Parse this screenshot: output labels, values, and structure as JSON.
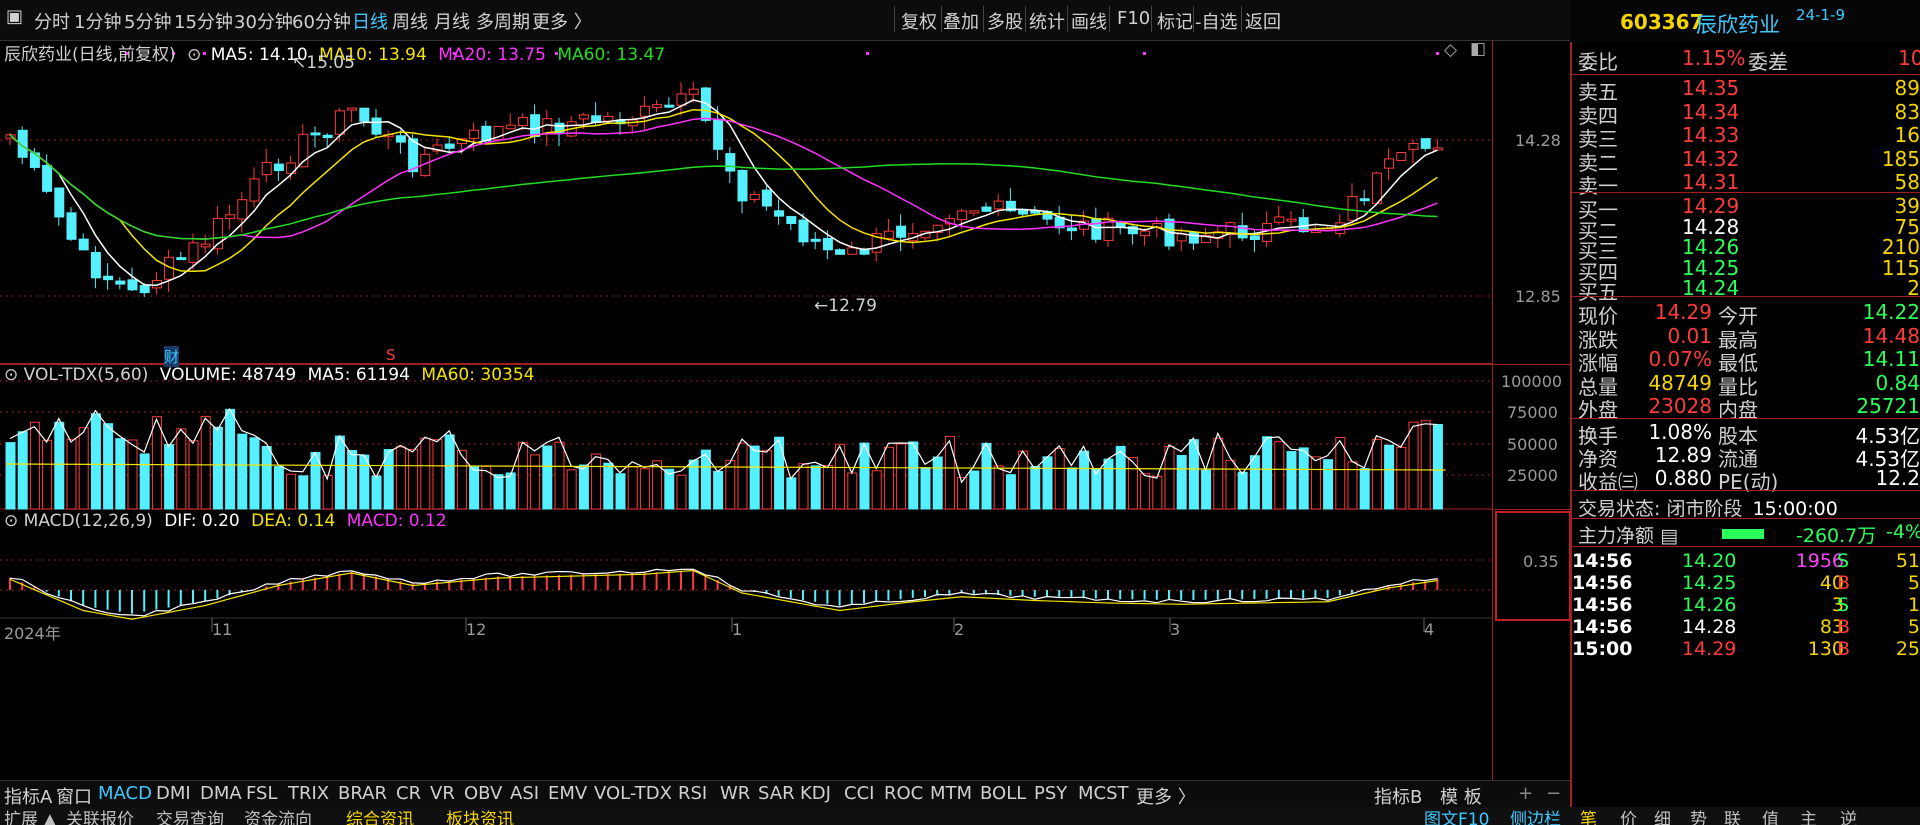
{
  "toolbar": {
    "periods": [
      "分时",
      "1分钟",
      "5分钟",
      "15分钟",
      "30分钟",
      "60分钟",
      "日线",
      "周线",
      "月线",
      "多周期",
      "更多 〉"
    ],
    "active_period": "日线",
    "actions": [
      "复权",
      "叠加",
      "多股",
      "统计",
      "画线",
      "F10",
      "标记",
      "-自选",
      "返回"
    ]
  },
  "stock": {
    "code": "603367",
    "name": "辰欣药业",
    "date_sup": "24-1-9"
  },
  "chart_legend": {
    "title": "辰欣药业(日线,前复权)",
    "ma5": "MA5: 14.10",
    "ma10": "MA10: 13.94",
    "ma20": "MA20: 13.75",
    "ma60": "MA60: 13.47",
    "high_marker": "15.05",
    "low_marker": "12.79",
    "tag_cai": "财",
    "tag_s": "S"
  },
  "price_axis": {
    "upper": "14.28",
    "lower": "12.85"
  },
  "volume_legend": {
    "name": "VOL-TDX(5,60)",
    "volume": "VOLUME: 48749",
    "ma5": "MA5: 61194",
    "ma60": "MA60: 30354"
  },
  "volume_axis": [
    "100000",
    "75000",
    "50000",
    "25000"
  ],
  "macd_legend": {
    "name": "MACD(12,26,9)",
    "dif": "DIF: 0.20",
    "dea": "DEA: 0.14",
    "macd": "MACD: 0.12"
  },
  "macd_axis": "0.35",
  "time_axis": [
    "2024年",
    "11",
    "12",
    "1",
    "2",
    "3",
    "4"
  ],
  "period_label": "日线",
  "colors": {
    "up": "#ff3b3b",
    "down": "#54f0ff",
    "ma5": "#ffffff",
    "ma10": "#f5e400",
    "ma20": "#ff33ff",
    "ma60": "#22dd22",
    "accent": "#3dc9ff",
    "frame": "#a02020"
  },
  "order_book": {
    "weibi_label": "委比",
    "weibi": "1.15%",
    "weicha_label": "委差",
    "weicha": "10",
    "asks": [
      {
        "label": "卖五",
        "price": "14.35",
        "vol": "89"
      },
      {
        "label": "卖四",
        "price": "14.34",
        "vol": "83"
      },
      {
        "label": "卖三",
        "price": "14.33",
        "vol": "16"
      },
      {
        "label": "卖二",
        "price": "14.32",
        "vol": "185"
      },
      {
        "label": "卖一",
        "price": "14.31",
        "vol": "58"
      }
    ],
    "bids": [
      {
        "label": "买一",
        "price": "14.29",
        "vol": "39"
      },
      {
        "label": "买二",
        "price": "14.28",
        "vol": "75"
      },
      {
        "label": "买三",
        "price": "14.26",
        "vol": "210"
      },
      {
        "label": "买四",
        "price": "14.25",
        "vol": "115"
      },
      {
        "label": "买五",
        "price": "14.24",
        "vol": "2"
      }
    ]
  },
  "quote": {
    "xianjia_l": "现价",
    "xianjia": "14.29",
    "jinkai_l": "今开",
    "jinkai": "14.22",
    "zhangdie_l": "涨跌",
    "zhangdie": "0.01",
    "zuigao_l": "最高",
    "zuigao": "14.48",
    "zhangfu_l": "涨幅",
    "zhangfu": "0.07%",
    "zuidi_l": "最低",
    "zuidi": "14.11",
    "zongliang_l": "总量",
    "zongliang": "48749",
    "liangbi_l": "量比",
    "liangbi": "0.84",
    "waipan_l": "外盘",
    "waipan": "23028",
    "neipan_l": "内盘",
    "neipan": "25721",
    "huanshou_l": "换手",
    "huanshou": "1.08%",
    "guben_l": "股本",
    "guben": "4.53亿",
    "jingzi_l": "净资",
    "jingzi": "12.89",
    "liutong_l": "流通",
    "liutong": "4.53亿",
    "shouyi_l": "收益㈢",
    "shouyi": "0.880",
    "pe_l": "PE(动)",
    "pe": "12.2"
  },
  "trade_status": {
    "label": "交易状态:",
    "status": "闭市阶段",
    "time": "15:00:00"
  },
  "main_flow": {
    "label": "主力净额",
    "value": "-260.7万",
    "pct": "-4%"
  },
  "ticks": [
    {
      "time": "14:56",
      "price": "14.20",
      "vol": "1956",
      "side": "S",
      "n": "51"
    },
    {
      "time": "14:56",
      "price": "14.25",
      "vol": "40",
      "side": "B",
      "n": "5"
    },
    {
      "time": "14:56",
      "price": "14.26",
      "vol": "3",
      "side": "S",
      "n": "1"
    },
    {
      "time": "14:56",
      "price": "14.28",
      "vol": "83",
      "side": "B",
      "n": "5"
    },
    {
      "time": "15:00",
      "price": "14.29",
      "vol": "130",
      "side": "B",
      "n": "25"
    }
  ],
  "indicators": [
    "指标A",
    "窗口",
    "MACD",
    "DMI",
    "DMA",
    "FSL",
    "TRIX",
    "BRAR",
    "CR",
    "VR",
    "OBV",
    "ASI",
    "EMV",
    "VOL-TDX",
    "RSI",
    "WR",
    "SAR",
    "KDJ",
    "CCI",
    "ROC",
    "MTM",
    "BOLL",
    "PSY",
    "MCST",
    "更多 〉"
  ],
  "active_indicator": "MACD",
  "indicator_right": [
    "指标B",
    "模 板"
  ],
  "status_tabs": [
    "扩展 ▲",
    "关联报价",
    "交易查询",
    "资金流向",
    "综合资讯",
    "板块资讯"
  ],
  "status_right": [
    "图文F10",
    "侧边栏",
    "笔",
    "价",
    "细",
    "势",
    "联",
    "值",
    "主",
    "逆"
  ]
}
